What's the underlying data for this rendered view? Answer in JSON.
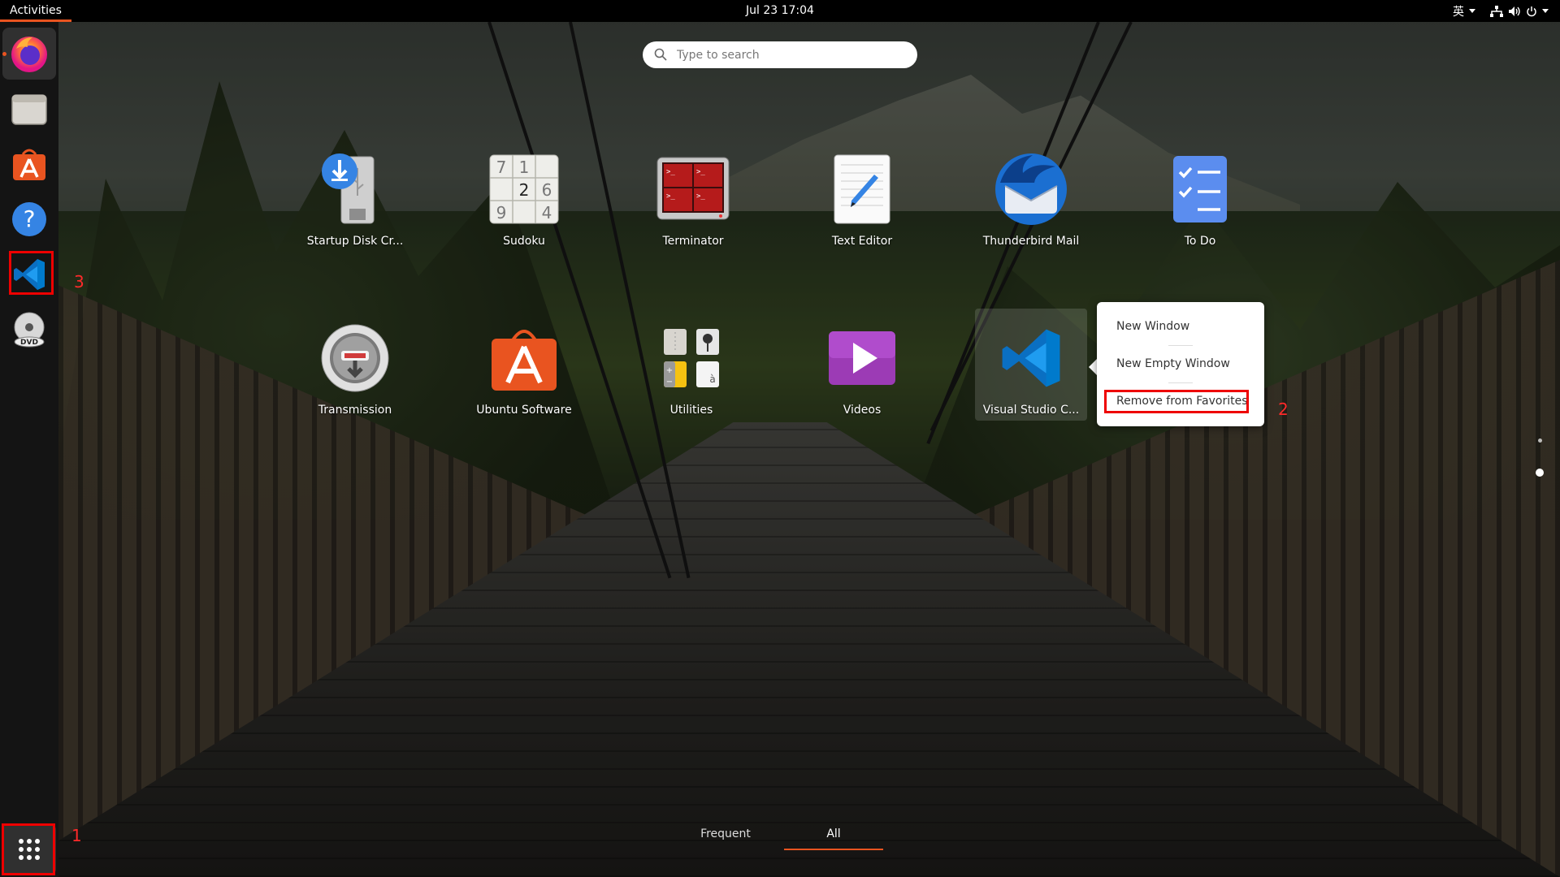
{
  "topbar": {
    "activities": "Activities",
    "clock": "Jul 23  17:04",
    "input_method": "英"
  },
  "search": {
    "placeholder": "Type to search"
  },
  "dock": {
    "items": [
      {
        "name": "firefox-icon",
        "running": true
      },
      {
        "name": "files-icon"
      },
      {
        "name": "ubuntu-software-icon"
      },
      {
        "name": "help-icon"
      },
      {
        "name": "vscode-icon"
      },
      {
        "name": "dvd-icon"
      }
    ],
    "show_apps": "show-applications-icon"
  },
  "apps": {
    "row1": [
      {
        "label": "Startup Disk Cr...",
        "icon": "usb-disk-icon"
      },
      {
        "label": "Sudoku",
        "icon": "sudoku-icon"
      },
      {
        "label": "Terminator",
        "icon": "terminator-icon"
      },
      {
        "label": "Text Editor",
        "icon": "text-editor-icon"
      },
      {
        "label": "Thunderbird Mail",
        "icon": "thunderbird-icon"
      },
      {
        "label": "To Do",
        "icon": "todo-icon"
      }
    ],
    "row2": [
      {
        "label": "Transmission",
        "icon": "transmission-icon"
      },
      {
        "label": "Ubuntu Software",
        "icon": "ubuntu-software-icon"
      },
      {
        "label": "Utilities",
        "icon": "utilities-folder-icon"
      },
      {
        "label": "Videos",
        "icon": "videos-icon"
      },
      {
        "label": "Visual Studio C...",
        "icon": "vscode-icon"
      }
    ]
  },
  "context_menu": {
    "items": [
      "New Window",
      "New Empty Window",
      "Remove from Favorites"
    ]
  },
  "annotations": {
    "one": "1",
    "two": "2",
    "three": "3"
  },
  "tabs": {
    "frequent": "Frequent",
    "all": "All"
  },
  "colors": {
    "accent": "#e95420",
    "highlight": "#e00000"
  }
}
